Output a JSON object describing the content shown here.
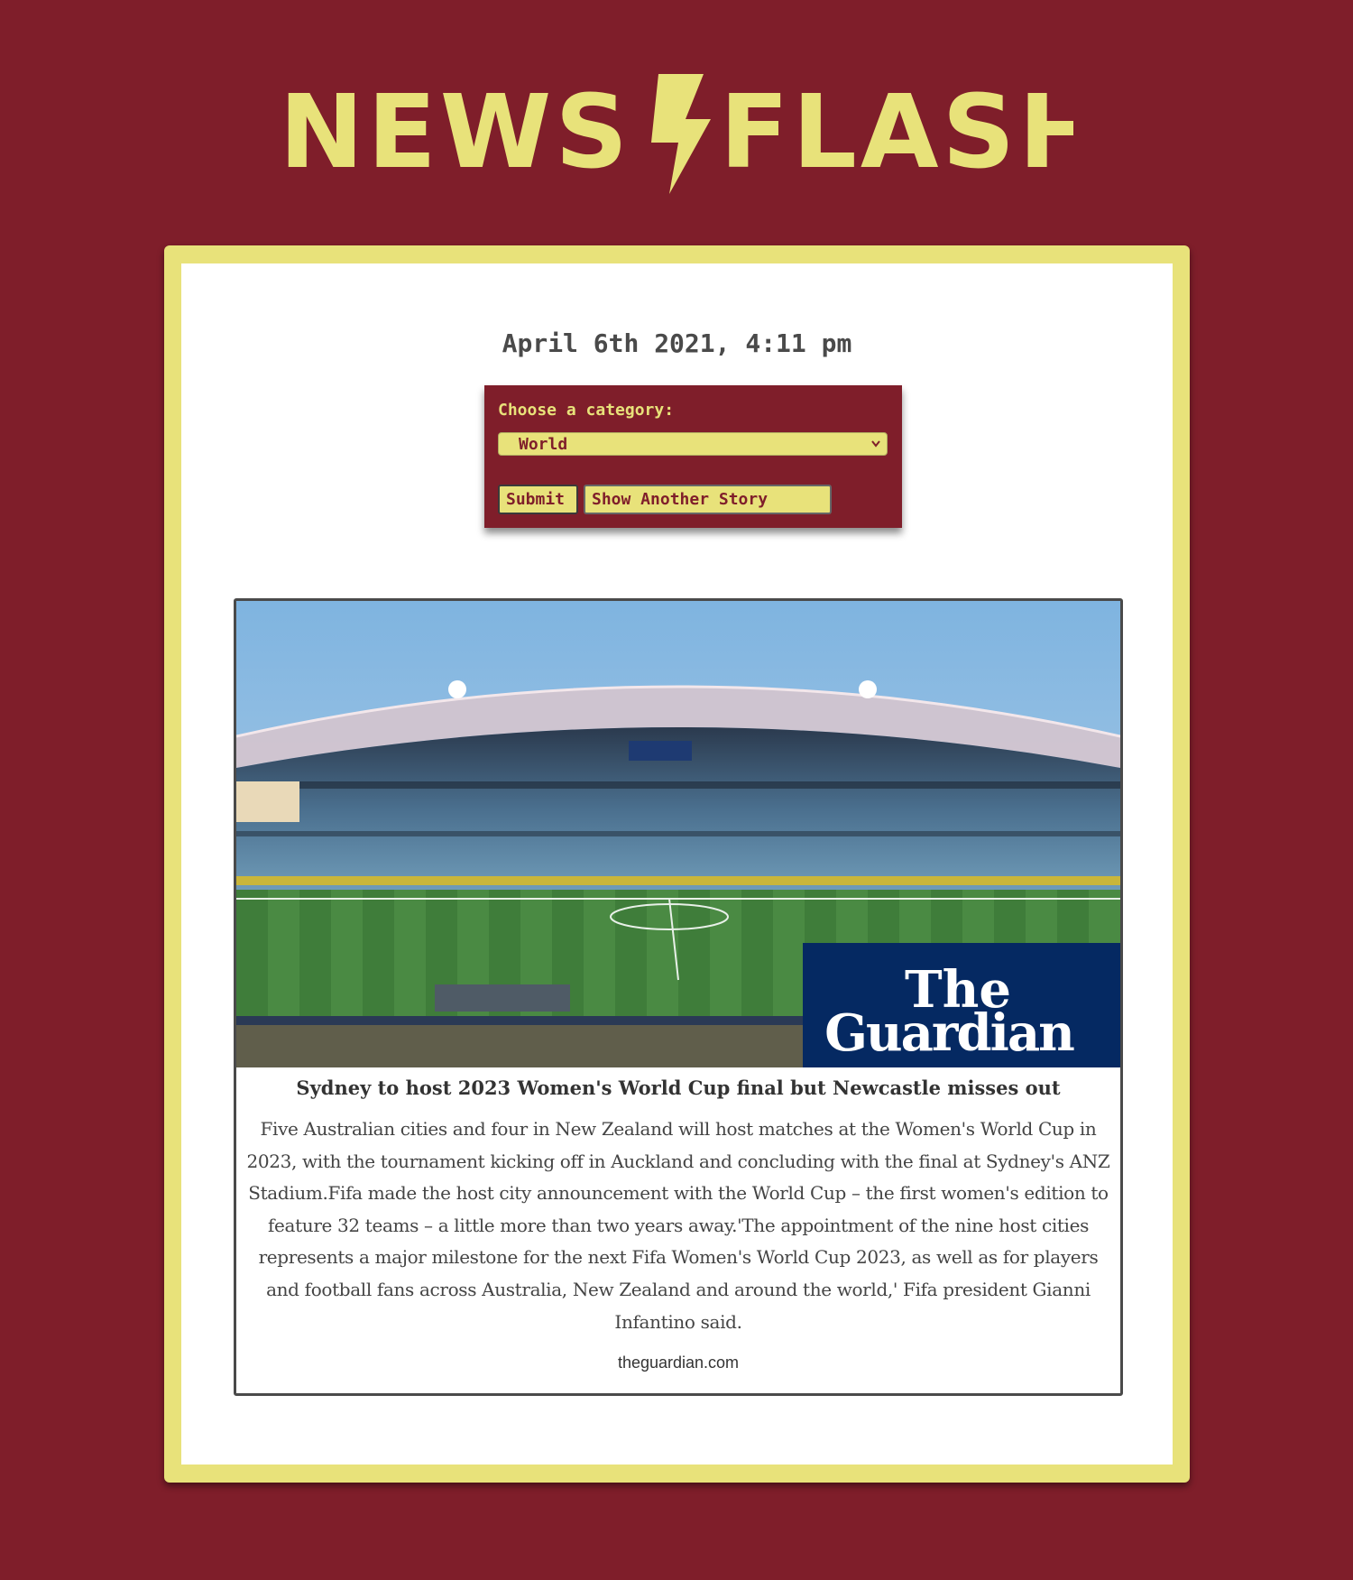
{
  "site": {
    "logo_left": "NEWS",
    "logo_right": "FLASH",
    "logo_icon": "lightning-bolt-icon",
    "colors": {
      "background": "#7f1e2a",
      "accent": "#e8e27a",
      "panel": "#ffffff"
    }
  },
  "header": {
    "datetime": "April 6th 2021, 4:11 pm"
  },
  "category_form": {
    "label": "Choose a category:",
    "selected": "World",
    "submit_label": "Submit",
    "another_label": "Show Another Story"
  },
  "story": {
    "image_watermark_line1": "The",
    "image_watermark_line2": "Guardian",
    "headline": "Sydney to host 2023 Women's World Cup final but Newcastle misses out",
    "body": "Five Australian cities and four in New Zealand will host matches at the Women's World Cup in 2023, with the tournament kicking off in Auckland and concluding with the final at Sydney's ANZ Stadium.Fifa made the host city announcement with the World Cup – the first women's edition to feature 32 teams – a little more than two years away.'The appointment of the nine host cities represents a major milestone for the next Fifa Women's World Cup 2023, as well as for players and football fans across Australia, New Zealand and around the world,' Fifa president Gianni Infantino said.",
    "source": "theguardian.com"
  }
}
